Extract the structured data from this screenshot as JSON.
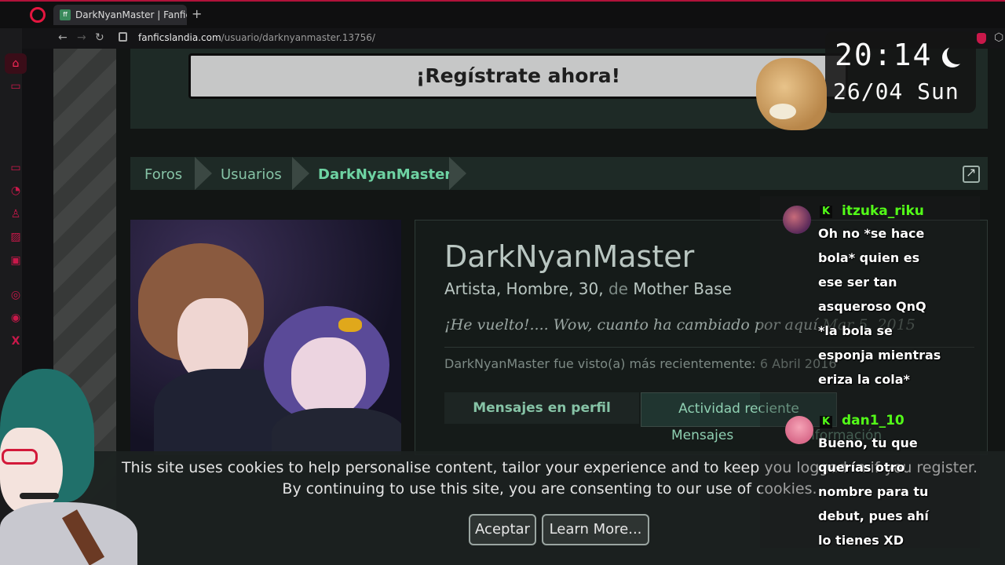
{
  "browser": {
    "tab_title": "DarkNyanMaster | Fanficsl",
    "favicon_text": "ff",
    "url_domain": "fanficslandia.com",
    "url_path": "/usuario/darknyanmaster.13756/",
    "new_tab": "+",
    "back": "←",
    "forward": "→",
    "reload": "↻",
    "ext": "⬡"
  },
  "sidebar": {
    "icons": [
      "home-icon",
      "game-icon",
      "controller-icon",
      "speed-icon",
      "flow-icon",
      "media-icon",
      "m-icon",
      "whatsapp-icon",
      "discord-icon",
      "x-icon"
    ],
    "glyphs": [
      "⌂",
      "▭",
      "▭",
      "◔",
      "♙",
      "▨",
      "▣",
      "◎",
      "◉",
      "X"
    ]
  },
  "banner": {
    "register_label": "¡Regístrate ahora!"
  },
  "breadcrumb": {
    "items": [
      "Foros",
      "Usuarios",
      "DarkNyanMaster"
    ]
  },
  "profile": {
    "username": "DarkNyanMaster",
    "info_main": "Artista, Hombre, 30,",
    "info_de": "de",
    "info_location": "Mother Base",
    "status_text": "¡He vuelto!.... Wow, cuanto ha cambiado por aquí",
    "status_date": "Mar 5, 2015",
    "last_seen": "DarkNyanMaster fue visto(a) más recientemente: 6 Abril 2016",
    "tabs": [
      "Mensajes en perfil",
      "Actividad reciente"
    ],
    "subtabs": [
      "Mensajes",
      "Información"
    ]
  },
  "cookie": {
    "line1": "This site uses cookies to help personalise content, tailor your experience and to keep you logged in if you register.",
    "line2": "By continuing to use this site, you are consenting to our use of cookies.",
    "accept_label": "Aceptar",
    "learn_label": "Learn More..."
  },
  "clock": {
    "time": "20:14",
    "date": "26/04 Sun"
  },
  "chat": {
    "badge": "K",
    "messages": [
      {
        "user": "itzuka_riku",
        "lines": [
          "Oh no *se hace",
          "bola* quien es",
          "ese ser tan",
          "asqueroso QnQ",
          "*la bola se",
          "esponja mientras",
          "eriza la cola*"
        ]
      },
      {
        "user": "dan1_10",
        "lines": [
          "Bueno, tu que",
          "querías otro",
          "nombre para tu",
          "debut, pues ahí",
          "lo tienes XD"
        ]
      }
    ]
  },
  "colors": {
    "accent_red": "#c9184a",
    "link_green": "#86c3a6",
    "chat_green": "#53fc18"
  }
}
